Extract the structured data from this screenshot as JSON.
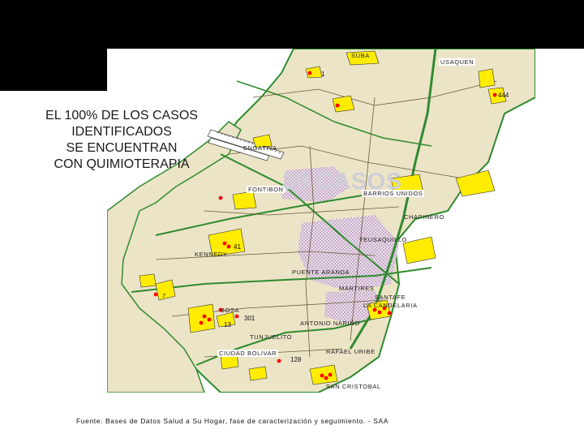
{
  "headline": {
    "lines": [
      "EL 100% DE LOS CASOS",
      "IDENTIFICADOS",
      "SE ENCUENTRAN",
      "CON QUIMIOTERAPIA"
    ]
  },
  "cases_label": "39 CASOS",
  "source_note": "Fuente: Bases de Datos Salud a Su Hogar, fase de caracterización y seguimiento. - SAA",
  "localities": {
    "usaquen": "USAQUEN",
    "suba": "SUBA",
    "engativa": "ENGATIVA",
    "fontibon": "FONTIBON",
    "barrios_unidos": "BARRIOS UNIDOS",
    "chapinero": "CHAPINERO",
    "teusaquillo": "TEUSAQUILLO",
    "kennedy": "KENNEDY",
    "puente_aranda": "PUENTE ARANDA",
    "martires": "MARTIRES",
    "santa_fe": "SANTAFE",
    "la_candelaria": "LA CANDELARIA",
    "antonio_narino": "ANTONIO NARIÑO",
    "tunjuelito": "TUNJUELITO",
    "ciudad_bolivar": "CIUDAD BOLIVAR",
    "rafael_uribe": "RAFAEL URIBE",
    "san_cristobal": "SAN CRISTOBAL",
    "usme_fragment": "7",
    "bosa_fragment": "BOSA"
  },
  "codes": {
    "c444": "444",
    "c301": "301",
    "c128": "128",
    "c13": "13",
    "c41": "41",
    "c1": "1"
  },
  "colors": {
    "land": "#ece4c7",
    "park": "#ffec00",
    "case_point": "#ff0000",
    "road": "#2e8b2e",
    "border": "#2e8b2e",
    "hatch": "#c9a3c8"
  }
}
